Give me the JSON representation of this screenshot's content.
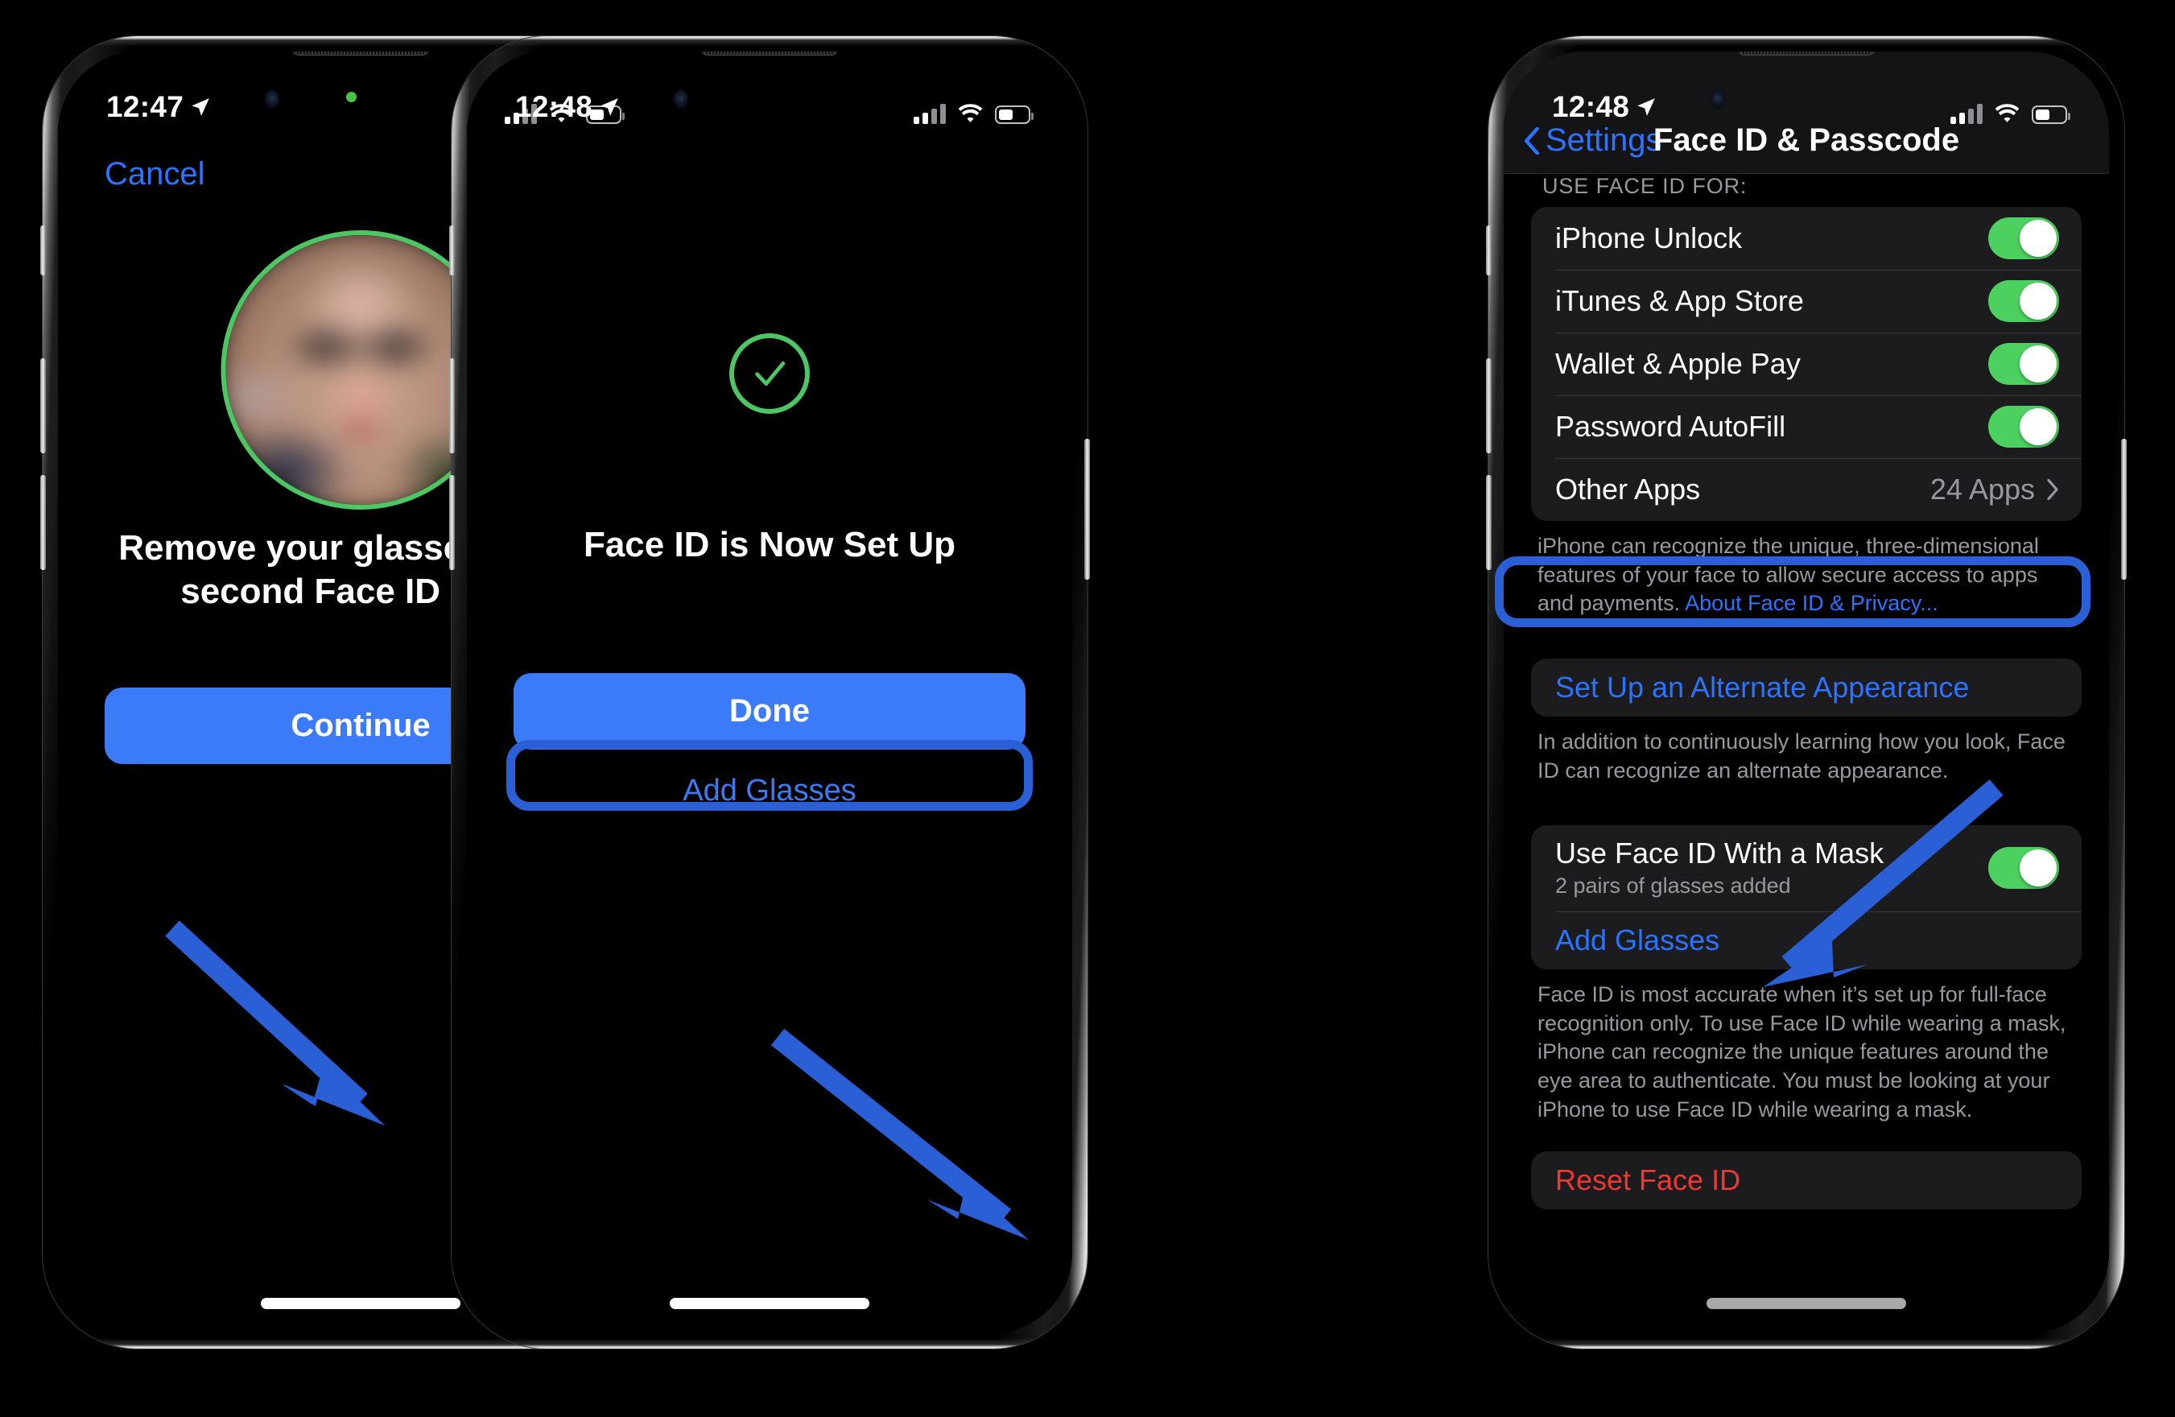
{
  "accent": {
    "blue": "#3b7bf7",
    "link_blue": "#2c73ff",
    "green": "#4cc764",
    "toggle_green": "#4cd160",
    "red": "#ea3a33",
    "annotation_blue": "#2a5fd6"
  },
  "phone1": {
    "status": {
      "time": "12:47",
      "location_icon": "location-arrow-icon",
      "signal_icon": "cellular-signal-icon",
      "wifi_icon": "wifi-icon",
      "battery_icon": "battery-icon",
      "recording_indicator": "green-recording-dot"
    },
    "cancel_label": "Cancel",
    "face_preview": "blurred-face-photo",
    "title": "Remove your glasses for the second Face ID scan.",
    "continue_label": "Continue"
  },
  "phone2": {
    "status": {
      "time": "12:48",
      "location_icon": "location-arrow-icon",
      "signal_icon": "cellular-signal-icon",
      "wifi_icon": "wifi-icon",
      "battery_icon": "battery-icon"
    },
    "check_icon": "checkmark-icon",
    "title": "Face ID is Now Set Up",
    "done_label": "Done",
    "add_glasses_label": "Add Glasses"
  },
  "phone3": {
    "status": {
      "time": "12:48",
      "location_icon": "location-arrow-icon",
      "signal_icon": "cellular-signal-icon",
      "wifi_icon": "wifi-icon",
      "battery_icon": "battery-icon"
    },
    "nav": {
      "back_label": "Settings",
      "back_icon": "chevron-left-icon",
      "title": "Face ID & Passcode"
    },
    "group_header": "USE FACE ID FOR:",
    "rows": [
      {
        "label": "iPhone Unlock",
        "type": "toggle",
        "on": true
      },
      {
        "label": "iTunes & App Store",
        "type": "toggle",
        "on": true
      },
      {
        "label": "Wallet & Apple Pay",
        "type": "toggle",
        "on": true
      },
      {
        "label": "Password AutoFill",
        "type": "toggle",
        "on": true
      },
      {
        "label": "Other Apps",
        "type": "disclosure",
        "value": "24 Apps"
      }
    ],
    "footnote1": "iPhone can recognize the unique, three-dimensional features of your face to allow secure access to apps and payments. ",
    "footnote1_link": "About Face ID & Privacy...",
    "alternate_appearance_label": "Set Up an Alternate Appearance",
    "footnote2": "In addition to continuously learning how you look, Face ID can recognize an alternate appearance.",
    "mask": {
      "title": "Use Face ID With a Mask",
      "subtitle": "2 pairs of glasses added",
      "toggle_on": true,
      "add_glasses_label": "Add Glasses"
    },
    "footnote3": "Face ID is most accurate when it’s set up for full-face recognition only. To use Face ID while wearing a mask, iPhone can recognize the unique features around the eye area to authenticate. You must be looking at your iPhone to use Face ID while wearing a mask.",
    "reset_label": "Reset Face ID"
  },
  "annotations": {
    "arrow1": "arrow-pointing-to-continue-button",
    "arrow2": "arrow-pointing-to-add-glasses-button",
    "arrow3": "arrow-pointing-to-add-glasses-row",
    "highlight2": "add-glasses-button-highlight",
    "highlight3": "add-glasses-row-highlight"
  }
}
